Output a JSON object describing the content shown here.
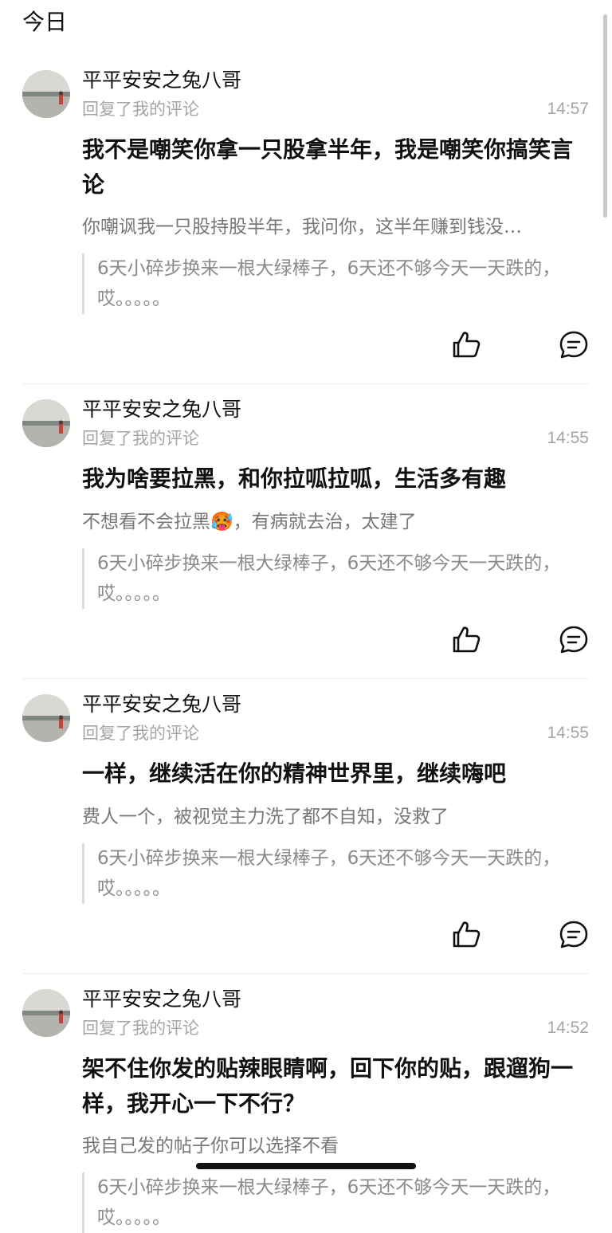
{
  "section": {
    "title": "今日"
  },
  "notifications": [
    {
      "username": "平平安安之兔八哥",
      "action": "回复了我的评论",
      "time": "14:57",
      "comment": "我不是嘲笑你拿一只股拿半年，我是嘲笑你搞笑言论",
      "reply_to": "你嘲讽我一只股持股半年，我问你，这半年赚到钱没…",
      "original_post": "6天小碎步换来一根大绿棒子，6天还不够今天一天跌的，哎。。。。。"
    },
    {
      "username": "平平安安之兔八哥",
      "action": "回复了我的评论",
      "time": "14:55",
      "comment": "我为啥要拉黑，和你拉呱拉呱，生活多有趣",
      "reply_to": "不想看不会拉黑🥵，有病就去治，太建了",
      "original_post": "6天小碎步换来一根大绿棒子，6天还不够今天一天跌的，哎。。。。。"
    },
    {
      "username": "平平安安之兔八哥",
      "action": "回复了我的评论",
      "time": "14:55",
      "comment": "一样，继续活在你的精神世界里，继续嗨吧",
      "reply_to": "费人一个，被视觉主力洗了都不自知，没救了",
      "original_post": "6天小碎步换来一根大绿棒子，6天还不够今天一天跌的，哎。。。。。"
    },
    {
      "username": "平平安安之兔八哥",
      "action": "回复了我的评论",
      "time": "14:52",
      "comment": "架不住你发的贴辣眼睛啊，回下你的贴，跟遛狗一样，我开心一下不行？",
      "reply_to": "我自己发的帖子你可以选择不看",
      "original_post": "6天小碎步换来一根大绿棒子，6天还不够今天一天跌的，哎。。。。。"
    }
  ],
  "icons": {
    "like": "thumbs-up-icon",
    "reply": "comment-bubble-icon"
  },
  "colors": {
    "primary_text": "#111111",
    "secondary_text": "#a5a5a5",
    "quote_text": "#8a8a8a",
    "divider": "#ededed"
  }
}
